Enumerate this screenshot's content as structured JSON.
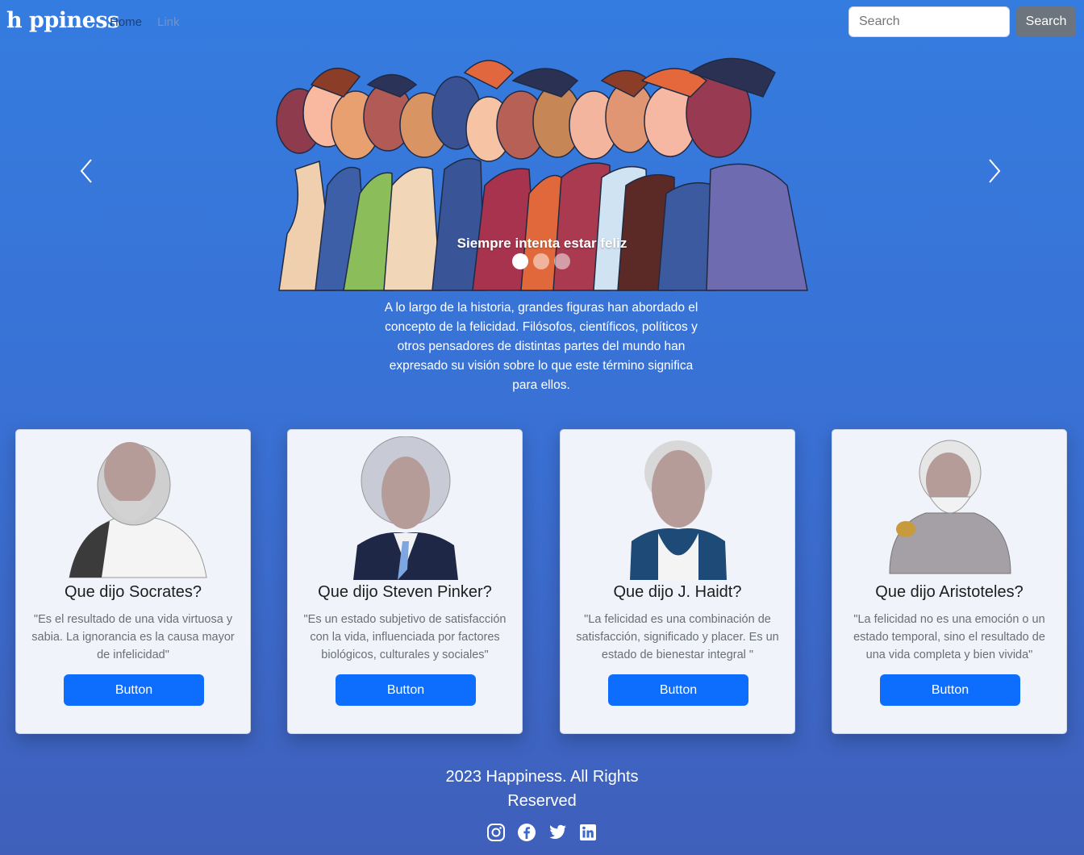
{
  "navbar": {
    "brand": "h ppiness",
    "links": [
      {
        "label": "Home"
      },
      {
        "label": "Link"
      }
    ],
    "search": {
      "placeholder": "Search",
      "button_label": "Search"
    }
  },
  "carousel": {
    "caption": "Siempre intenta estar feliz",
    "slide_count": 3,
    "active_slide": 1
  },
  "intro": "A lo largo de la historia, grandes figuras han abordado el concepto de la felicidad. Filósofos, científicos, políticos y otros pensadores de distintas partes del mundo han expresado su visión sobre lo que este término significa para ellos.",
  "cards": [
    {
      "title": "Que dijo Socrates?",
      "text": "\"Es el resultado de una vida virtuosa y sabia. La ignorancia es la causa mayor de infelicidad\"",
      "button": "Button"
    },
    {
      "title": "Que dijo Steven Pinker?",
      "text": "\"Es un estado subjetivo de satisfacción con la vida, influenciada por factores biológicos, culturales y sociales\"",
      "button": "Button"
    },
    {
      "title": "Que dijo J. Haidt?",
      "text": "\"La felicidad es una combinación de satisfacción, significado y placer. Es un estado de bienestar integral \"",
      "button": "Button"
    },
    {
      "title": "Que dijo Aristoteles?",
      "text": "\"La felicidad no es una emoción o un estado temporal, sino el resultado de una vida completa y bien vivida\"",
      "button": "Button"
    }
  ],
  "footer": {
    "text": "2023 Happiness. All Rights Reserved",
    "social_icons": [
      "instagram-icon",
      "facebook-icon",
      "twitter-icon",
      "linkedin-icon"
    ]
  },
  "colors": {
    "primary_button": "#0d6efd",
    "secondary_button": "#6c757d",
    "background": "#3a6fd2"
  }
}
